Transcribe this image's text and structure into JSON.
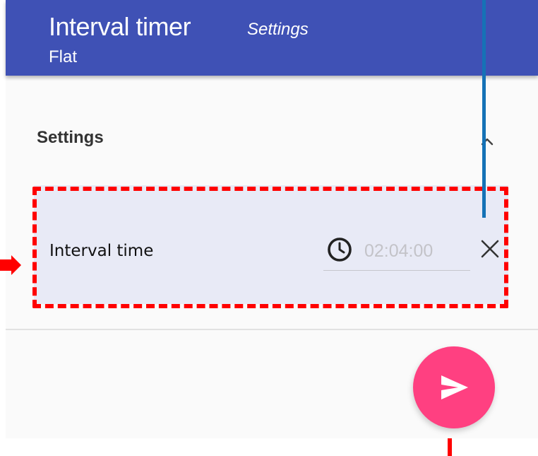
{
  "toolbar": {
    "title": "Interval timer",
    "subtitle": "Settings",
    "preset": "Flat"
  },
  "section": {
    "title": "Settings",
    "toggle_icon": "chevron-up-icon"
  },
  "setting": {
    "label": "Interval time",
    "value": "02:04:00",
    "field_icon": "clock-icon",
    "clear_icon": "close-icon"
  },
  "fab": {
    "icon": "send-icon"
  },
  "colors": {
    "primary": "#3f51b5",
    "accent": "#ff4081",
    "row_background": "#e8eaf6",
    "annotation_red": "#ff0000",
    "annotation_blue": "#1572b6"
  }
}
